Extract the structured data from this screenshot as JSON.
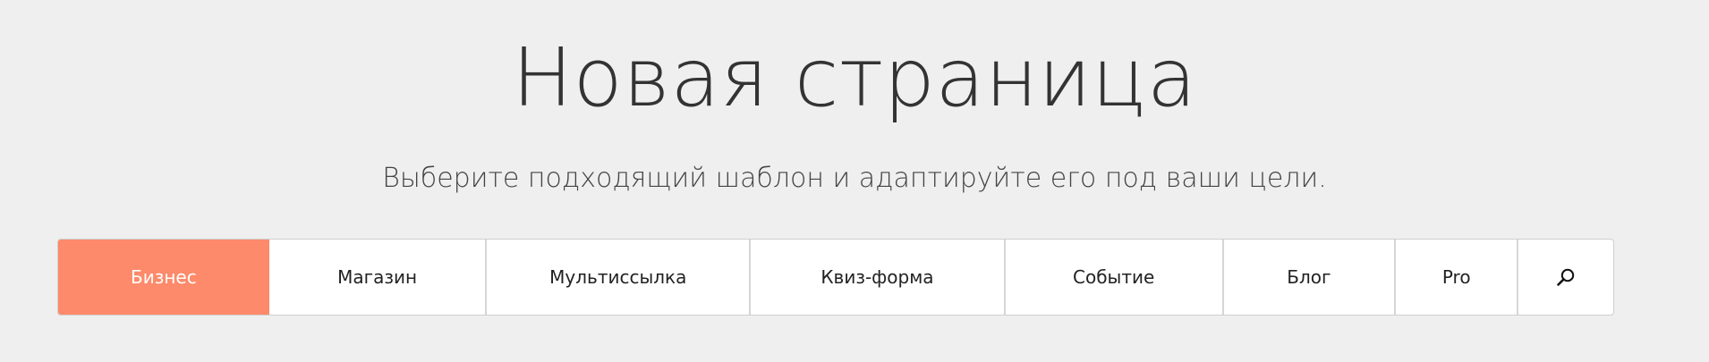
{
  "header": {
    "title": "Новая страница",
    "subtitle": "Выберите подходящий шаблон и адаптируйте его под ваши цели."
  },
  "tabs": [
    {
      "label": "Бизнес",
      "active": true
    },
    {
      "label": "Магазин",
      "active": false
    },
    {
      "label": "Мультиссылка",
      "active": false
    },
    {
      "label": "Квиз-форма",
      "active": false
    },
    {
      "label": "Событие",
      "active": false
    },
    {
      "label": "Блог",
      "active": false
    },
    {
      "label": "Pro",
      "active": false
    }
  ],
  "search": {
    "icon": "search-icon"
  },
  "colors": {
    "background": "#efefef",
    "accent": "#fd8a6a",
    "text": "#333333",
    "tab_background": "#ffffff"
  }
}
